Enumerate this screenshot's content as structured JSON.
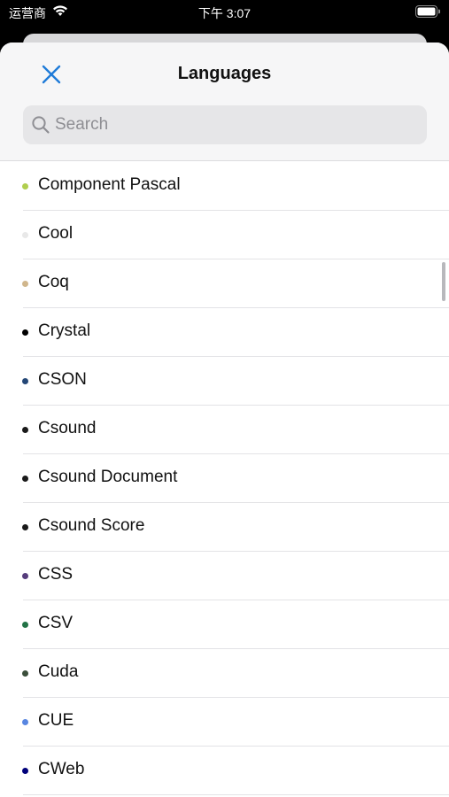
{
  "status_bar": {
    "carrier": "运营商",
    "time": "下午 3:07"
  },
  "sheet": {
    "title": "Languages",
    "close_icon": "close-x-icon",
    "search": {
      "placeholder": "Search",
      "value": ""
    }
  },
  "colors": {
    "accent": "#1f7bd8"
  },
  "languages": [
    {
      "name": "Component Pascal",
      "color": "#b0ce4e"
    },
    {
      "name": "Cool",
      "color": "#e8e8e8"
    },
    {
      "name": "Coq",
      "color": "#d0b68c"
    },
    {
      "name": "Crystal",
      "color": "#000100"
    },
    {
      "name": "CSON",
      "color": "#244776"
    },
    {
      "name": "Csound",
      "color": "#1a1a1a"
    },
    {
      "name": "Csound Document",
      "color": "#1a1a1a"
    },
    {
      "name": "Csound Score",
      "color": "#1a1a1a"
    },
    {
      "name": "CSS",
      "color": "#563d7c"
    },
    {
      "name": "CSV",
      "color": "#237346"
    },
    {
      "name": "Cuda",
      "color": "#3a4e3a"
    },
    {
      "name": "CUE",
      "color": "#5886e1"
    },
    {
      "name": "CWeb",
      "color": "#00007a"
    }
  ]
}
